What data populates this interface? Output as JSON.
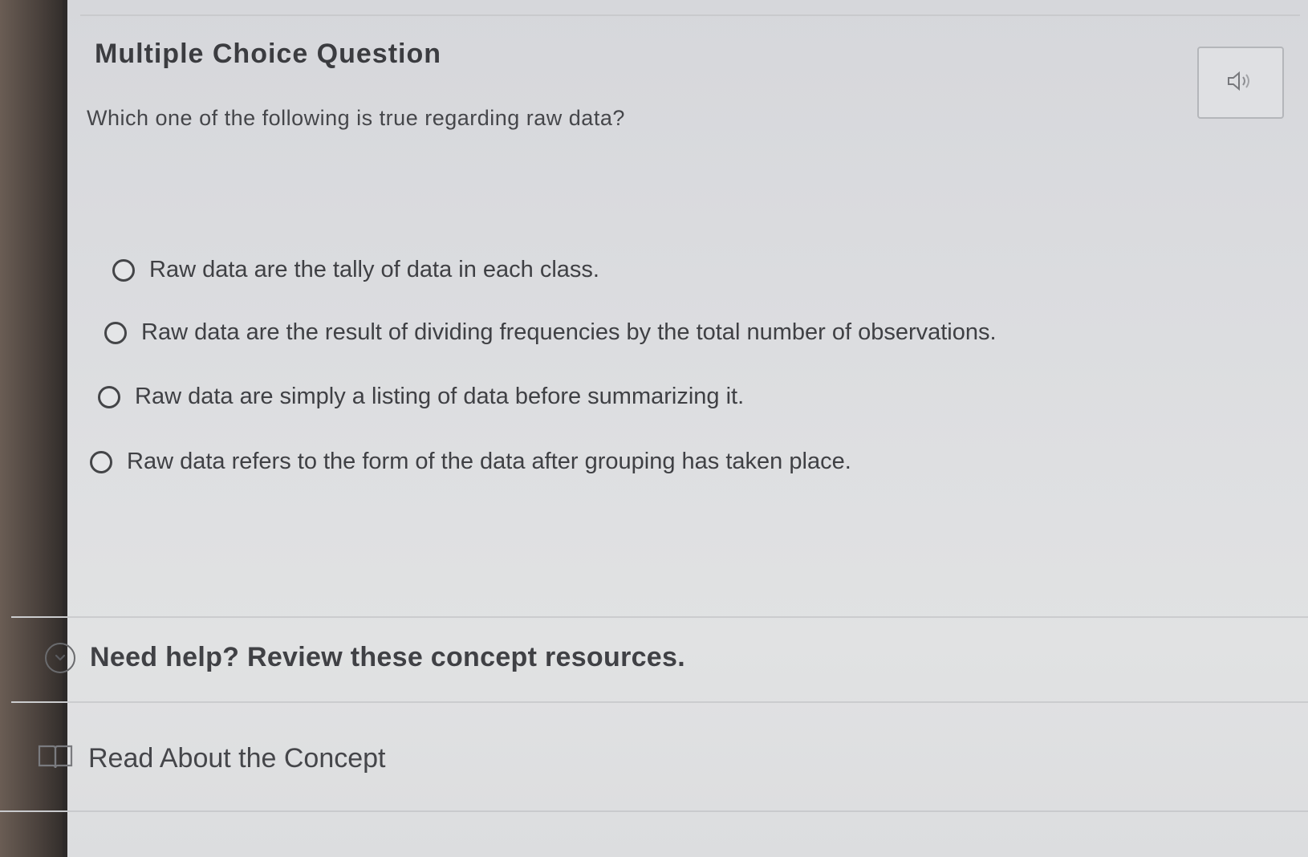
{
  "question": {
    "type_label": "Multiple Choice Question",
    "prompt": "Which one of the following is true regarding raw data?",
    "audio_icon": "speaker-icon",
    "options": [
      {
        "label": "Raw data are the tally of data in each class.",
        "selected": false
      },
      {
        "label": "Raw data are the result of dividing frequencies by the total number of observations.",
        "selected": false
      },
      {
        "label": "Raw data are simply a listing of data before summarizing it.",
        "selected": false
      },
      {
        "label": "Raw data refers to the form of the data after grouping has taken place.",
        "selected": false
      }
    ]
  },
  "help": {
    "toggle_label": "Need help? Review these concept resources.",
    "toggle_icon": "chevron-down-icon",
    "resources": [
      {
        "label": "Read About the Concept",
        "icon": "book-icon"
      }
    ]
  }
}
